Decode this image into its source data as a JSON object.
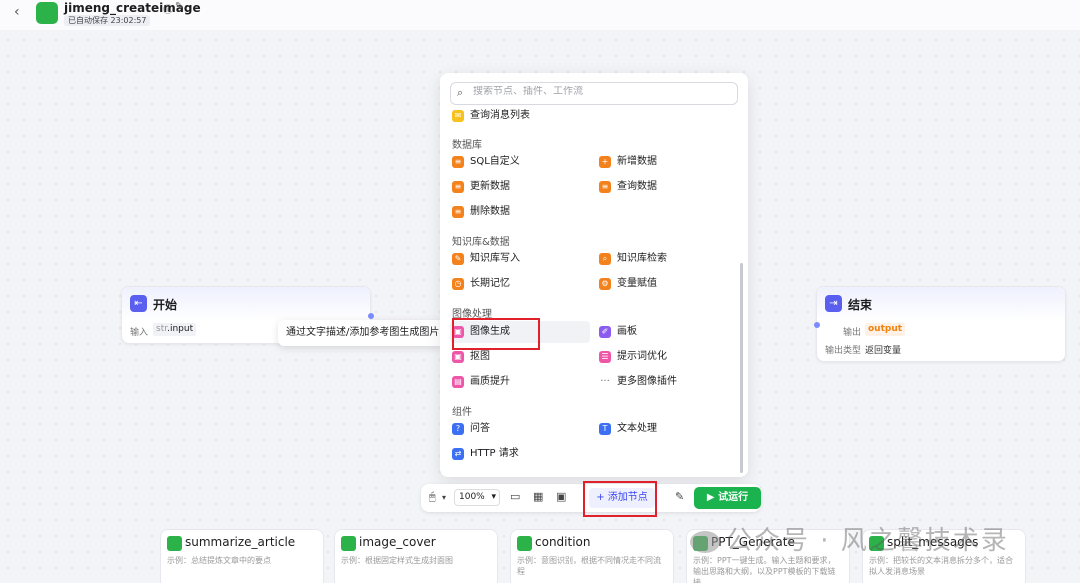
{
  "header": {
    "back_icon": "‹",
    "app_name": "jimeng_createimage",
    "save_status": "已自动保存 23:02:57"
  },
  "start_node": {
    "title": "开始",
    "input_label": "输入",
    "input_type": "str",
    "input_name": "input"
  },
  "end_node": {
    "title": "结束",
    "output_label": "输出",
    "output_value": "output",
    "output_type_label": "输出类型",
    "output_type_value": "返回变量"
  },
  "tooltip": "通过文字描述/添加参考图生成图片",
  "panel": {
    "search_placeholder": "搜索节点、插件、工作流",
    "partial_item": "查询消息列表",
    "sections": {
      "database": "数据库",
      "knowledge": "知识库&数据",
      "image": "图像处理",
      "component": "组件"
    },
    "items": {
      "sql": "SQL自定义",
      "add_data": "新增数据",
      "update_data": "更新数据",
      "query_data": "查询数据",
      "delete_data": "删除数据",
      "kb_write": "知识库写入",
      "kb_search": "知识库检索",
      "long_memory": "长期记忆",
      "var_assign": "变量赋值",
      "image_gen": "图像生成",
      "canvas": "画板",
      "cutout": "抠图",
      "prompt_opt": "提示词优化",
      "quality_up": "画质提升",
      "more_plugins": "更多图像插件",
      "qa": "问答",
      "text_proc": "文本处理",
      "http": "HTTP 请求"
    }
  },
  "toolbar": {
    "zoom": "100%",
    "add_node": "添加节点",
    "run": "试运行"
  },
  "bottom_nodes": [
    {
      "title": "summarize_article",
      "desc": "示例：总结提炼文章中的要点"
    },
    {
      "title": "image_cover",
      "desc": "示例：根据固定样式生成封面图"
    },
    {
      "title": "condition",
      "desc": "示例：意图识别，根据不同情况走不同流程"
    },
    {
      "title": "PPT_Generate",
      "desc": "示例：PPT一键生成。输入主题和要求，输出思路和大纲，以及PPT模板的下载链接"
    },
    {
      "title": "split_messages",
      "desc": "示例：把较长的文本消息拆分多个，适合拟人发消息场景"
    }
  ],
  "watermark": "公众号 · 风之馨技术录"
}
